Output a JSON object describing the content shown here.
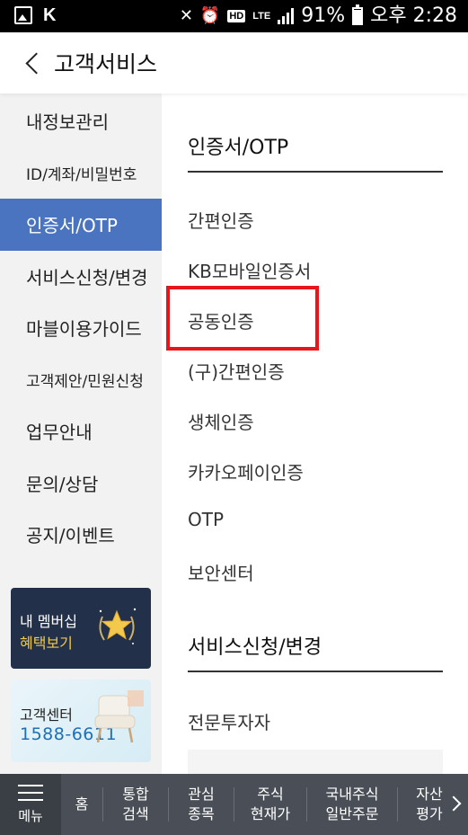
{
  "status_bar": {
    "battery": "91%",
    "time": "오후 2:28",
    "hd_label": "HD",
    "lte_label": "LTE"
  },
  "header": {
    "title": "고객서비스"
  },
  "sidebar": {
    "items": [
      {
        "label": "내정보관리"
      },
      {
        "label": "ID/계좌/비밀번호"
      },
      {
        "label": "인증서/OTP",
        "active": true
      },
      {
        "label": "서비스신청/변경"
      },
      {
        "label": "마블이용가이드"
      },
      {
        "label": "고객제안/민원신청"
      },
      {
        "label": "업무안내"
      },
      {
        "label": "문의/상담"
      },
      {
        "label": "공지/이벤트"
      }
    ],
    "member_promo": {
      "line1": "내 멤버십",
      "line2": "혜택보기"
    },
    "center_promo": {
      "line1": "고객센터",
      "phone": "1588-6611"
    }
  },
  "main": {
    "section1_title": "인증서/OTP",
    "section1_items": [
      "간편인증",
      "KB모바일인증서",
      "공동인증",
      "(구)간편인증",
      "생체인증",
      "카카오페이인증",
      "OTP",
      "보안센터"
    ],
    "section2_title": "서비스신청/변경",
    "section2_items": [
      "전문투자자"
    ]
  },
  "bottom_nav": {
    "menu_label": "메뉴",
    "items": [
      {
        "line1": "홈",
        "line2": ""
      },
      {
        "line1": "통합",
        "line2": "검색"
      },
      {
        "line1": "관심",
        "line2": "종목"
      },
      {
        "line1": "주식",
        "line2": "현재가"
      },
      {
        "line1": "국내주식",
        "line2": "일반주문"
      },
      {
        "line1": "자산",
        "line2": "평가"
      }
    ]
  },
  "colors": {
    "active_sidebar": "#4a74c0",
    "highlight_box": "#e8151b",
    "bottom_nav": "#4a4f57",
    "member_promo_bg": "#23304a",
    "phone_text": "#1e6fb5"
  }
}
